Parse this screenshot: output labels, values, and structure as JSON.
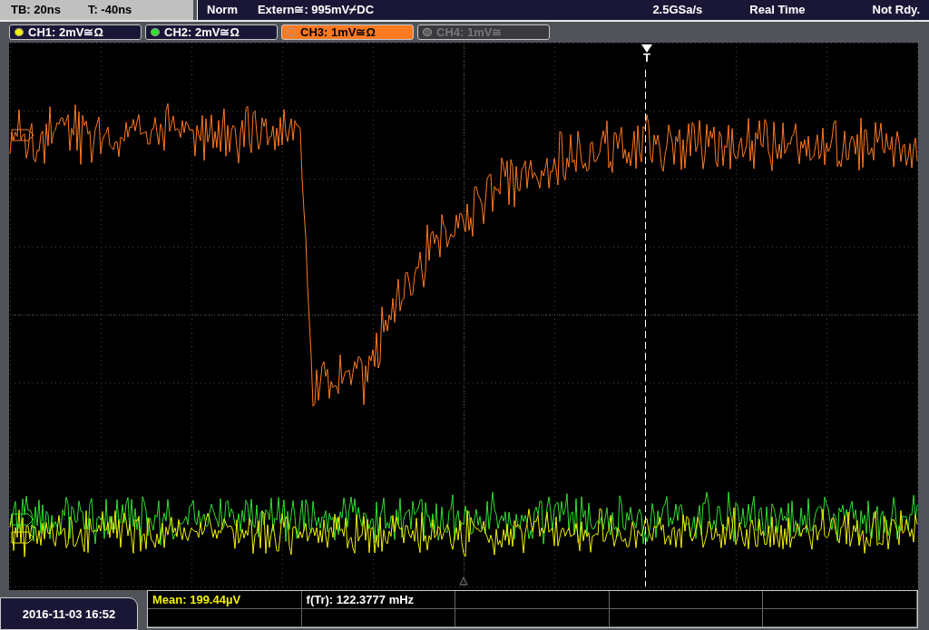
{
  "status_left": {
    "timebase": "TB: 20ns",
    "trigger_time": "T: -40ns"
  },
  "status_right": {
    "mode": "Norm",
    "trigger": "Extern≅: 995mV⌿DC",
    "sample_rate": "2.5GSa/s",
    "acquisition": "Real Time",
    "state": "Not Rdy."
  },
  "channels": [
    {
      "label": "CH1: 2mV≅Ω",
      "color": "#f0f000",
      "selected": false,
      "enabled": true
    },
    {
      "label": "CH2: 2mV≅Ω",
      "color": "#30e030",
      "selected": false,
      "enabled": true
    },
    {
      "label": "CH3: 1mV≅Ω",
      "color": "#ff7a20",
      "selected": true,
      "enabled": true
    },
    {
      "label": "CH4: 1mV≅",
      "color": "#606060",
      "selected": false,
      "enabled": false
    }
  ],
  "trigger_marker": "T",
  "date": "2016-11-03 16:52",
  "measurements": [
    {
      "text": "Mean: 199.44µV",
      "color": "#f0f000"
    },
    {
      "text": "f(Tr): 122.3777 mHz",
      "color": "#ffffff"
    }
  ]
}
